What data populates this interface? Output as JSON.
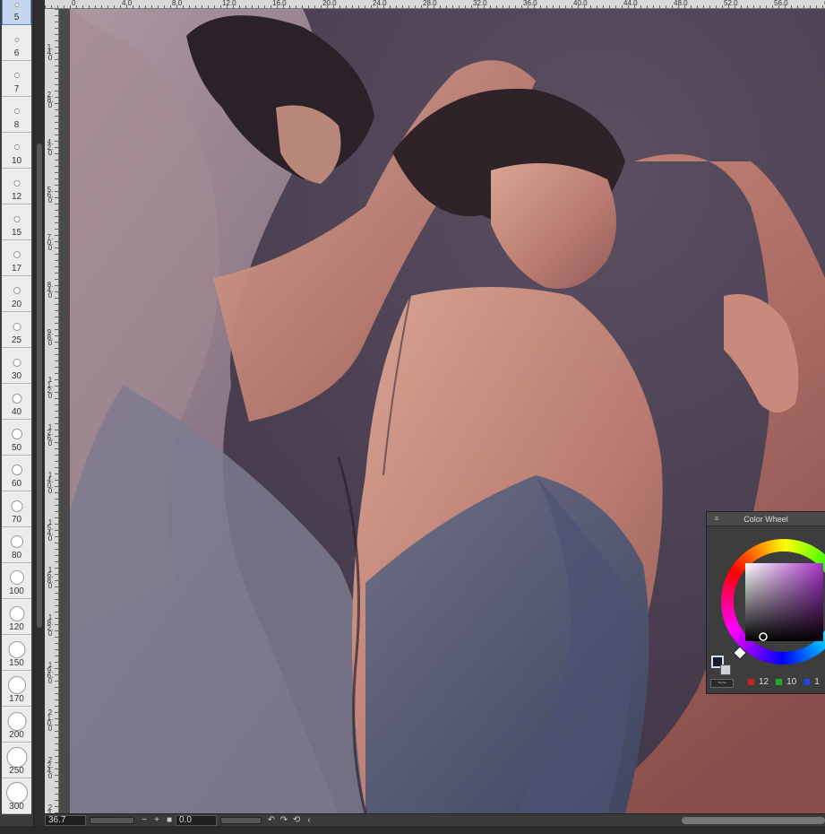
{
  "brush_sizes": [
    "5",
    "6",
    "7",
    "8",
    "10",
    "12",
    "15",
    "17",
    "20",
    "25",
    "30",
    "40",
    "50",
    "60",
    "70",
    "80",
    "100",
    "120",
    "150",
    "170",
    "200",
    "250",
    "300"
  ],
  "ruler_top_labels": [
    "0",
    "4.0",
    "8.0",
    "12.0",
    "16.0",
    "20.0",
    "24.0",
    "28.0",
    "32.0",
    "36.0",
    "40.0",
    "44.0",
    "48.0",
    "52.0",
    "56.0",
    "60.0"
  ],
  "ruler_left_labels": [
    "1.4.0",
    "2.8.0",
    "4.2.0",
    "5.6.0",
    "7.0.0",
    "8.4.0",
    "9.8.0",
    "11.2.0",
    "12.6.0",
    "14.0.0",
    "15.4.0",
    "16.8.0",
    "18.2.0",
    "19.6.0",
    "21.0.0",
    "22.4.0",
    "23.8.0"
  ],
  "bottom_bar": {
    "zoom_value": "36.7",
    "minus_label": "−",
    "plus_label": "+",
    "stop_label": "■",
    "rotation_value": "0.0",
    "rotate_left_label": "↶",
    "rotate_right_label": "↷",
    "reset_label": "⟲",
    "collapse_label": "‹"
  },
  "color_wheel": {
    "title": "Color Wheel",
    "menu_icon": "≡",
    "r_value": "12",
    "g_value": "10",
    "b_value": "1",
    "main_color": "#1a1a22",
    "sub_color": "#cfcfd6",
    "hue_color": "#a533c7",
    "colors": {
      "r": "#cc2222",
      "g": "#22aa22",
      "b": "#2244dd"
    }
  },
  "icons": {
    "menu": "hamburger-menu-icon",
    "rotate_left": "rotate-left-icon",
    "rotate_right": "rotate-right-icon",
    "reset": "reset-rotation-icon",
    "collapse": "chevron-left-icon"
  }
}
